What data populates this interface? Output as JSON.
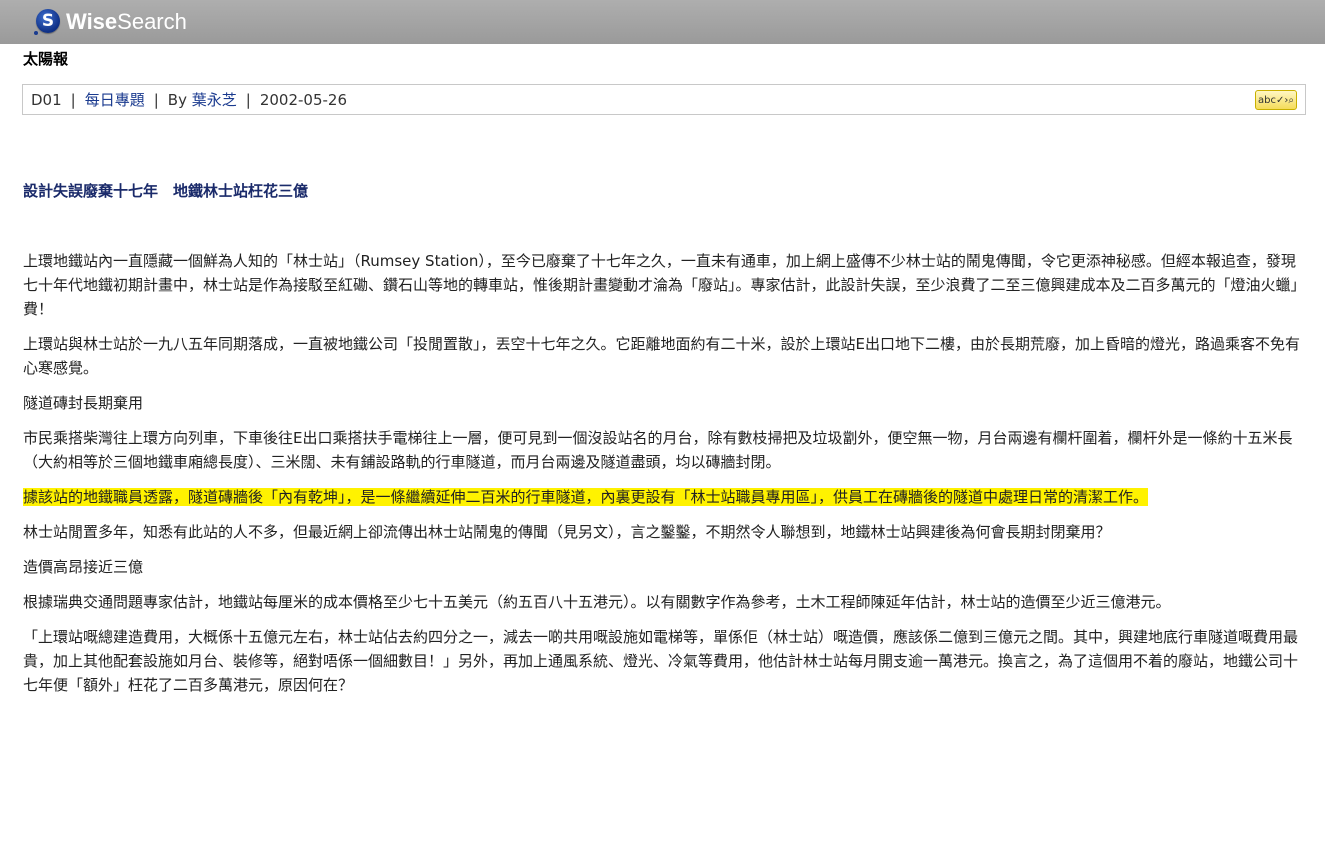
{
  "app": {
    "name_bold": "Wise",
    "name_regular": "Search",
    "logo_letter": "S"
  },
  "paper": "太陽報",
  "meta": {
    "page": "D01",
    "section": "每日專題",
    "author_prefix": "By",
    "author": "葉永芝",
    "date": "2002-05-26",
    "separator": "|",
    "spell_label": "abc✓›⌕"
  },
  "headline": "設計失誤廢棄十七年　地鐵林士站枉花三億",
  "paragraphs": [
    "上環地鐵站內一直隱藏一個鮮為人知的「林士站」（Rumsey Station），至今已廢棄了十七年之久，一直未有通車，加上網上盛傳不少林士站的鬧鬼傳聞，令它更添神秘感。但經本報追查，發現七十年代地鐵初期計畫中，林士站是作為接駁至紅磡、鑽石山等地的轉車站，惟後期計畫變動才淪為「廢站」。專家估計，此設計失誤，至少浪費了二至三億興建成本及二百多萬元的「燈油火蠟」費！",
    "上環站與林士站於一九八五年同期落成，一直被地鐵公司「投閒置散」，丟空十七年之久。它距離地面約有二十米，設於上環站E出口地下二樓，由於長期荒廢，加上昏暗的燈光，路過乘客不免有心寒感覺。",
    "隧道磚封長期棄用",
    "市民乘搭柴灣往上環方向列車，下車後往E出口乘搭扶手電梯往上一層，便可見到一個沒設站名的月台，除有數枝掃把及垃圾劏外，便空無一物，月台兩邊有欄杆圍着，欄杆外是一條約十五米長（大約相等於三個地鐵車廂總長度）、三米闊、未有鋪設路軌的行車隧道，而月台兩邊及隧道盡頭，均以磚牆封閉。",
    "據該站的地鐵職員透露，隧道磚牆後「內有乾坤」，是一條繼續延伸二百米的行車隧道，內裏更設有「林士站職員專用區」，供員工在磚牆後的隧道中處理日常的清潔工作。",
    "林士站閒置多年，知悉有此站的人不多，但最近網上卻流傳出林士站鬧鬼的傳聞（見另文），言之鑿鑿，不期然令人聯想到，地鐵林士站興建後為何會長期封閉棄用？",
    "造價高昂接近三億",
    "根據瑞典交通問題專家估計，地鐵站每厘米的成本價格至少七十五美元（約五百八十五港元）。以有關數字作為參考，土木工程師陳延年估計，林士站的造價至少近三億港元。",
    "「上環站嘅總建造費用，大概係十五億元左右，林士站佔去約四分之一，減去一啲共用嘅設施如電梯等，單係佢（林士站）嘅造價，應該係二億到三億元之間。其中，興建地底行車隧道嘅費用最貴，加上其他配套設施如月台、裝修等，絕對唔係一個細數目！」另外，再加上通風系統、燈光、冷氣等費用，他估計林士站每月開支逾一萬港元。換言之，為了這個用不着的廢站，地鐵公司十七年便「額外」枉花了二百多萬港元，原因何在？"
  ],
  "highlight_color": "#fff200",
  "highlighted_paragraph_index": 4
}
